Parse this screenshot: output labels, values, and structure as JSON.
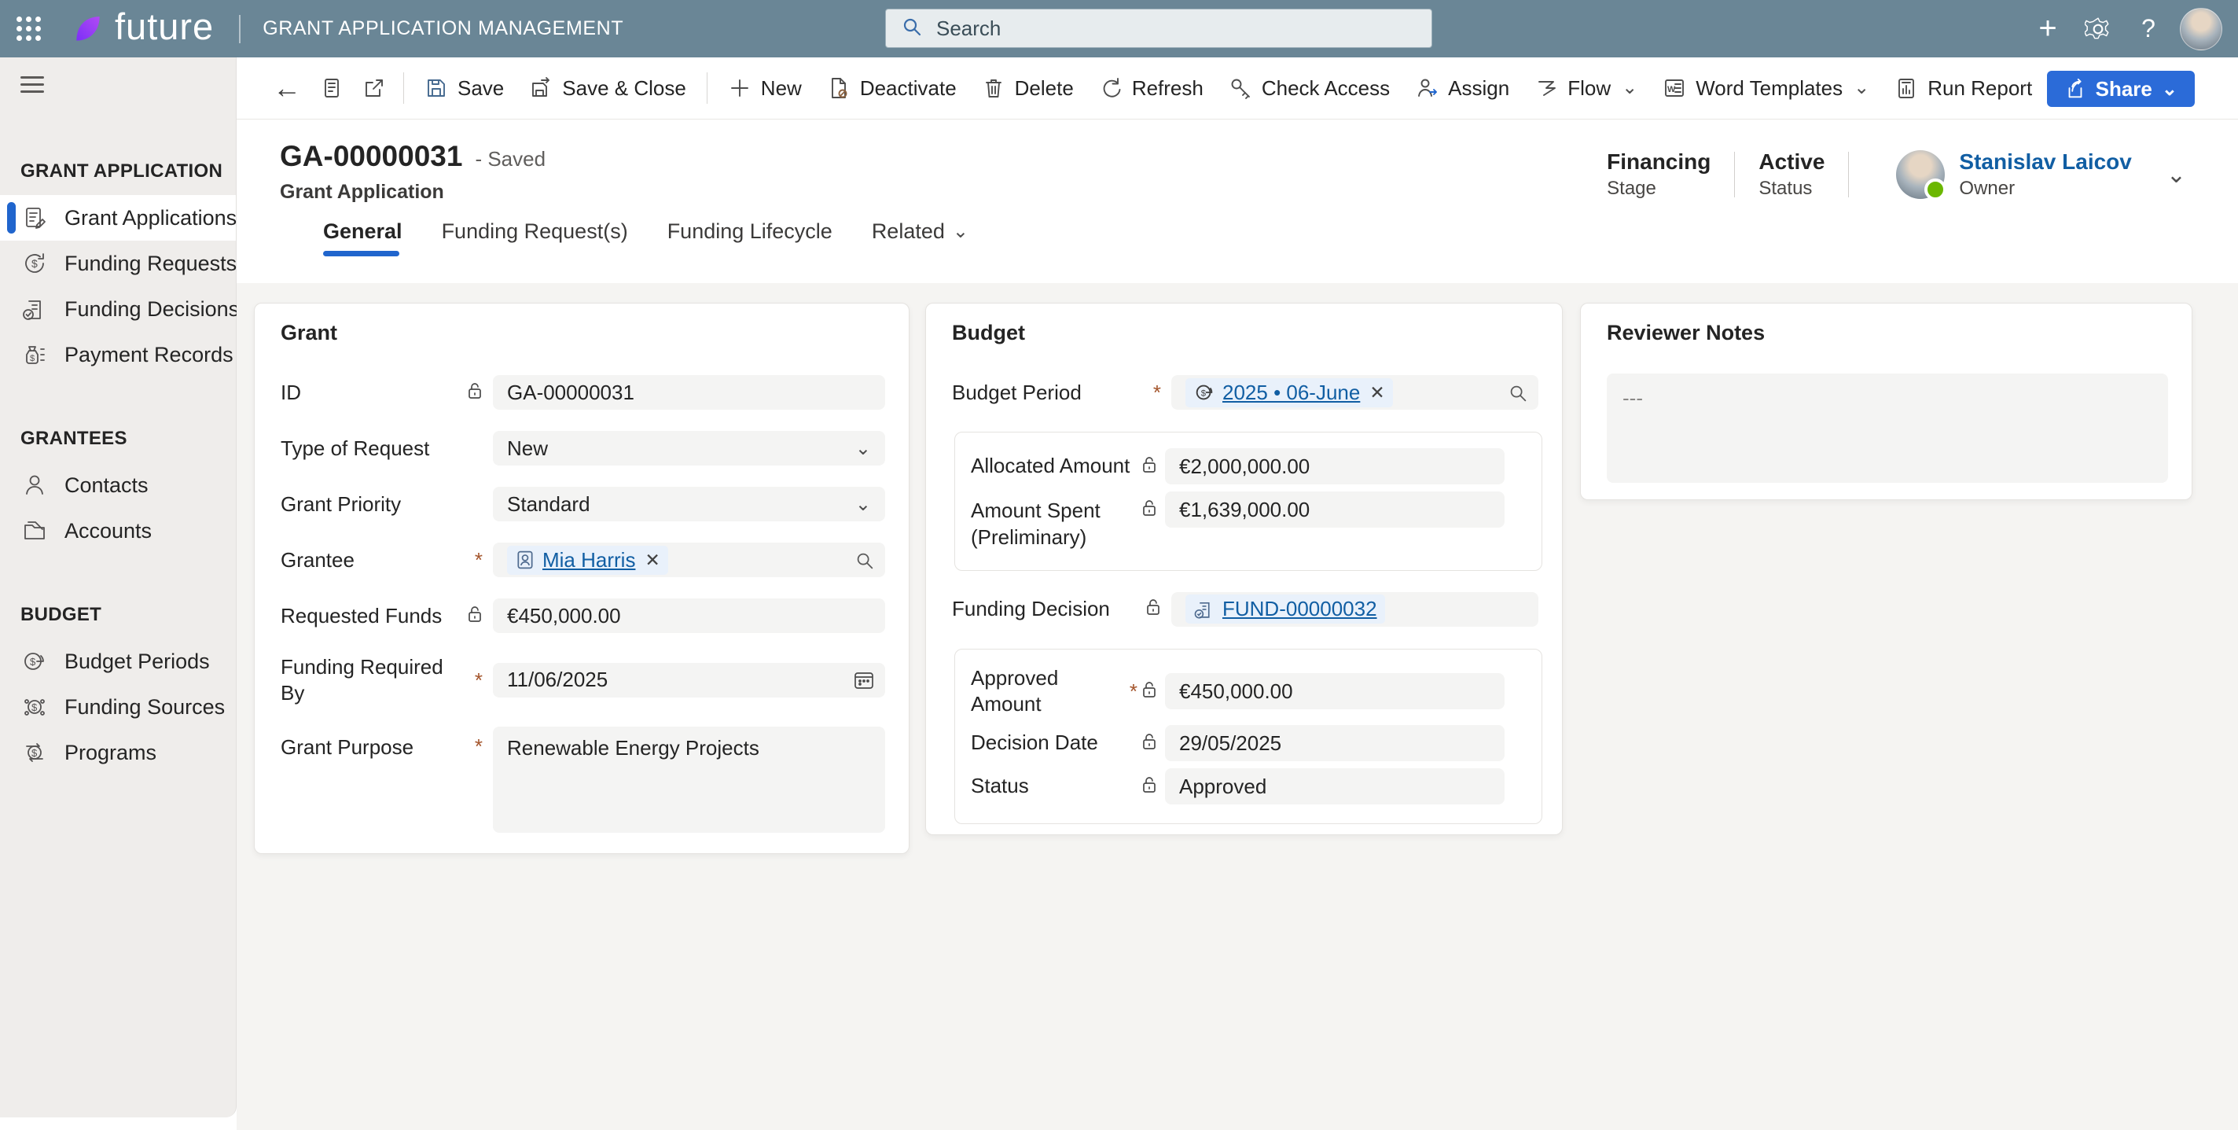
{
  "topbar": {
    "logo_text": "future",
    "app_title": "GRANT APPLICATION MANAGEMENT",
    "search": {
      "placeholder": "Search"
    }
  },
  "glyphs": {
    "back": "←",
    "plus": "+",
    "help": "?",
    "chevron": "⌄",
    "close": "✕",
    "required": "*"
  },
  "command_bar": {
    "buttons": [
      {
        "label": "Save"
      },
      {
        "label": "Save & Close"
      },
      {
        "label": "New"
      },
      {
        "label": "Deactivate"
      },
      {
        "label": "Delete"
      },
      {
        "label": "Refresh"
      },
      {
        "label": "Check Access"
      },
      {
        "label": "Assign"
      },
      {
        "label": "Flow"
      },
      {
        "label": "Word Templates"
      },
      {
        "label": "Run Report"
      }
    ],
    "share_label": "Share"
  },
  "sidebar": {
    "sections": [
      {
        "title": "GRANT APPLICATION",
        "items": [
          {
            "label": "Grant Applications",
            "active": true
          },
          {
            "label": "Funding Requests"
          },
          {
            "label": "Funding Decisions"
          },
          {
            "label": "Payment Records"
          }
        ]
      },
      {
        "title": "GRANTEES",
        "items": [
          {
            "label": "Contacts"
          },
          {
            "label": "Accounts"
          }
        ]
      },
      {
        "title": "BUDGET",
        "items": [
          {
            "label": "Budget Periods"
          },
          {
            "label": "Funding Sources"
          },
          {
            "label": "Programs"
          }
        ]
      }
    ]
  },
  "record_header": {
    "id": "GA-00000031",
    "save_status": "- Saved",
    "entity": "Grant Application",
    "stage": {
      "value": "Financing",
      "label": "Stage"
    },
    "status": {
      "value": "Active",
      "label": "Status"
    },
    "owner": {
      "value": "Stanislav Laicov",
      "label": "Owner"
    }
  },
  "tabs": [
    {
      "label": "General",
      "active": true
    },
    {
      "label": "Funding Request(s)"
    },
    {
      "label": "Funding Lifecycle"
    },
    {
      "label": "Related",
      "has_menu": true
    }
  ],
  "cards": {
    "grant": {
      "title": "Grant",
      "fields": [
        {
          "label": "ID",
          "locked": true,
          "type": "text",
          "value": "GA-00000031"
        },
        {
          "label": "Type of Request",
          "type": "dropdown",
          "value": "New"
        },
        {
          "label": "Grant Priority",
          "type": "dropdown",
          "value": "Standard"
        },
        {
          "label": "Grantee",
          "required": true,
          "type": "lookup",
          "value": "Mia Harris"
        },
        {
          "label": "Requested Funds",
          "locked": true,
          "type": "text",
          "value": "€450,000.00"
        },
        {
          "label": "Funding Required By",
          "required": true,
          "type": "date",
          "value": "11/06/2025"
        },
        {
          "label": "Grant Purpose",
          "required": true,
          "type": "textarea",
          "value": "Renewable Energy Projects"
        }
      ]
    },
    "budget": {
      "title": "Budget",
      "budget_period": {
        "label": "Budget Period",
        "required": true,
        "value": "2025 • 06-June"
      },
      "allocated": {
        "label": "Allocated Amount",
        "locked": true,
        "value": "€2,000,000.00"
      },
      "spent": {
        "label": "Amount Spent (Preliminary)",
        "locked": true,
        "value": "€1,639,000.00"
      },
      "funding_decision": {
        "label": "Funding Decision",
        "locked": true,
        "value": "FUND-00000032"
      },
      "approved": {
        "label": "Approved Amount",
        "required": true,
        "locked": true,
        "value": "€450,000.00"
      },
      "decision_date": {
        "label": "Decision Date",
        "locked": true,
        "value": "29/05/2025"
      },
      "status": {
        "label": "Status",
        "locked": true,
        "value": "Approved"
      }
    },
    "reviewer_notes": {
      "title": "Reviewer Notes",
      "value": "---"
    }
  },
  "colors": {
    "topbar": "#6a8696",
    "accent_blue": "#2065cd",
    "link_blue": "#115ea3",
    "share_button": "#2b6bd8",
    "presence_green": "#6bb700",
    "content_bg": "#f5f4f2"
  }
}
